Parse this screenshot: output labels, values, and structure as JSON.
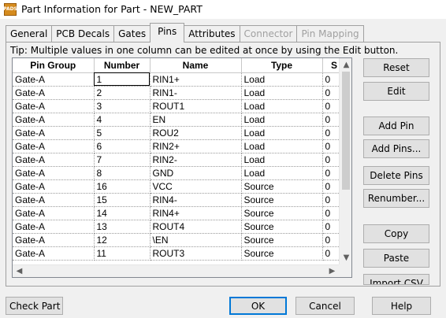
{
  "window": {
    "title": "Part Information for Part - NEW_PART",
    "icon_text": "PADS"
  },
  "tabs": [
    {
      "label": "General",
      "state": "normal"
    },
    {
      "label": "PCB Decals",
      "state": "normal"
    },
    {
      "label": "Gates",
      "state": "normal"
    },
    {
      "label": "Pins",
      "state": "active"
    },
    {
      "label": "Attributes",
      "state": "normal"
    },
    {
      "label": "Connector",
      "state": "disabled"
    },
    {
      "label": "Pin Mapping",
      "state": "disabled"
    }
  ],
  "tip": "Tip: Multiple values in one column can be edited at once by using the Edit button.",
  "grid": {
    "columns": [
      "Pin Group",
      "Number",
      "Name",
      "Type",
      "S"
    ],
    "rows": [
      [
        "Gate-A",
        "1",
        "RIN1+",
        "Load",
        "0"
      ],
      [
        "Gate-A",
        "2",
        "RIN1-",
        "Load",
        "0"
      ],
      [
        "Gate-A",
        "3",
        "ROUT1",
        "Load",
        "0"
      ],
      [
        "Gate-A",
        "4",
        "EN",
        "Load",
        "0"
      ],
      [
        "Gate-A",
        "5",
        "ROU2",
        "Load",
        "0"
      ],
      [
        "Gate-A",
        "6",
        "RIN2+",
        "Load",
        "0"
      ],
      [
        "Gate-A",
        "7",
        "RIN2-",
        "Load",
        "0"
      ],
      [
        "Gate-A",
        "8",
        "GND",
        "Load",
        "0"
      ],
      [
        "Gate-A",
        "16",
        "VCC",
        "Source",
        "0"
      ],
      [
        "Gate-A",
        "15",
        "RIN4-",
        "Source",
        "0"
      ],
      [
        "Gate-A",
        "14",
        "RIN4+",
        "Source",
        "0"
      ],
      [
        "Gate-A",
        "13",
        "ROUT4",
        "Source",
        "0"
      ],
      [
        "Gate-A",
        "12",
        "\\EN",
        "Source",
        "0"
      ],
      [
        "Gate-A",
        "11",
        "ROUT3",
        "Source",
        "0"
      ]
    ]
  },
  "side_buttons": {
    "reset": "Reset",
    "edit": "Edit",
    "add_pin": "Add Pin",
    "add_pins": "Add Pins...",
    "delete_pins": "Delete Pins",
    "renumber": "Renumber...",
    "copy": "Copy",
    "paste": "Paste",
    "import_csv": "Import CSV"
  },
  "footer": {
    "check_part": "Check Part",
    "ok": "OK",
    "cancel": "Cancel",
    "help": "Help"
  },
  "colors": {
    "accent": "#0078d7",
    "button_face": "#e1e1e1",
    "dialog_bg": "#f0f0f0"
  }
}
